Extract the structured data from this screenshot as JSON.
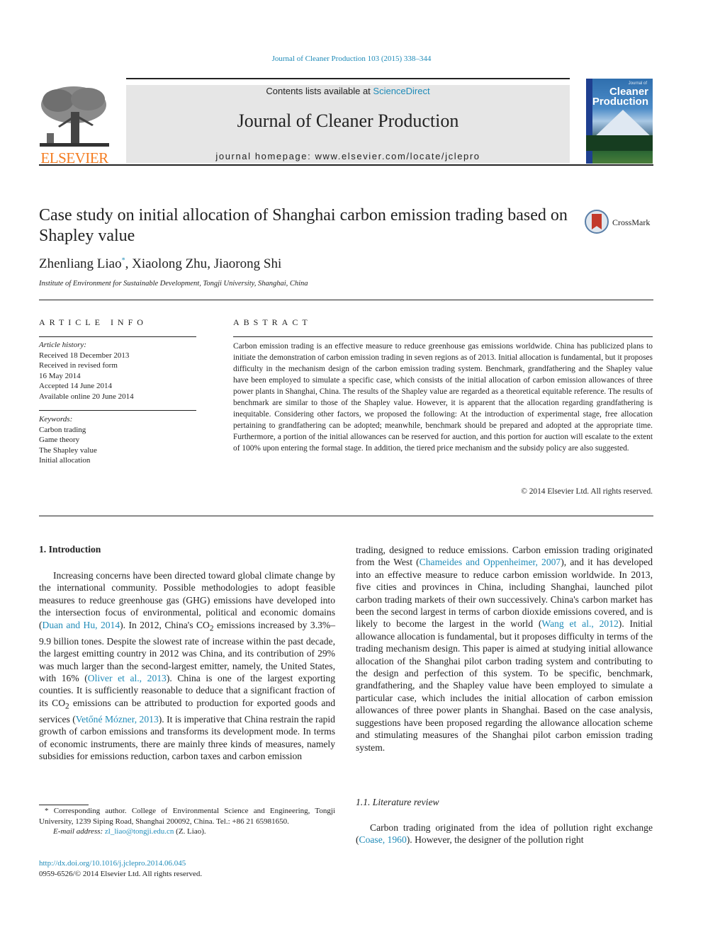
{
  "header": {
    "citation": "Journal of Cleaner Production 103 (2015) 338–344",
    "contents_prefix": "Contents lists available at ",
    "contents_link": "ScienceDirect",
    "journal_title": "Journal of Cleaner Production",
    "homepage": "journal homepage: www.elsevier.com/locate/jclepro",
    "publisher_logo": "ELSEVIER",
    "cover_small": "Journal of",
    "cover_title_1": "Cleaner",
    "cover_title_2": "Production",
    "brand_color": "#f47c20",
    "link_color": "#1f8bb8"
  },
  "article": {
    "title": "Case study on initial allocation of Shanghai carbon emission trading based on Shapley value",
    "crossmark_label": "CrossMark",
    "authors": [
      {
        "name": "Zhenliang Liao",
        "mark": "*"
      },
      {
        "name": "Xiaolong Zhu"
      },
      {
        "name": "Jiaorong Shi"
      }
    ],
    "author_sep": ", ",
    "affiliation": "Institute of Environment for Sustainable Development, Tongji University, Shanghai, China"
  },
  "article_info": {
    "heading": "ARTICLE INFO",
    "history_label": "Article history:",
    "history": [
      "Received 18 December 2013",
      "Received in revised form",
      "16 May 2014",
      "Accepted 14 June 2014",
      "Available online 20 June 2014"
    ],
    "keywords_label": "Keywords:",
    "keywords": [
      "Carbon trading",
      "Game theory",
      "The Shapley value",
      "Initial allocation"
    ]
  },
  "abstract": {
    "heading": "ABSTRACT",
    "text": "Carbon emission trading is an effective measure to reduce greenhouse gas emissions worldwide. China has publicized plans to initiate the demonstration of carbon emission trading in seven regions as of 2013. Initial allocation is fundamental, but it proposes difficulty in the mechanism design of the carbon emission trading system. Benchmark, grandfathering and the Shapley value have been employed to simulate a specific case, which consists of the initial allocation of carbon emission allowances of three power plants in Shanghai, China. The results of the Shapley value are regarded as a theoretical equitable reference. The results of benchmark are similar to those of the Shapley value. However, it is apparent that the allocation regarding grandfathering is inequitable. Considering other factors, we proposed the following: At the introduction of experimental stage, free allocation pertaining to grandfathering can be adopted; meanwhile, benchmark should be prepared and adopted at the appropriate time. Furthermore, a portion of the initial allowances can be reserved for auction, and this portion for auction will escalate to the extent of 100% upon entering the formal stage. In addition, the tiered price mechanism and the subsidy policy are also suggested.",
    "copyright": "© 2014 Elsevier Ltd. All rights reserved."
  },
  "body": {
    "section1_heading": "1.  Introduction",
    "p1": [
      {
        "t": "Increasing concerns have been directed toward global climate change by the international community. Possible methodologies to adopt feasible measures to reduce greenhouse gas (GHG) emissions have developed into the intersection focus of environmental, political and economic domains ("
      },
      {
        "t": "Duan and Hu, 2014",
        "link": true
      },
      {
        "t": "). In 2012, China's CO"
      },
      {
        "t": "2",
        "sub": true
      },
      {
        "t": " emissions increased by 3.3%–9.9 billion tones. Despite the slowest rate of increase within the past decade, the largest emitting country in 2012 was China, and its contribution of 29% was much larger than the second-largest emitter, namely, the United States, with 16% ("
      },
      {
        "t": "Oliver et al., 2013",
        "link": true
      },
      {
        "t": "). China is one of the largest exporting counties. It is sufficiently reasonable to deduce that a significant fraction of its CO"
      },
      {
        "t": "2",
        "sub": true
      },
      {
        "t": " emissions can be attributed to production for exported goods and services ("
      },
      {
        "t": "Vetőné Mózner, 2013",
        "link": true
      },
      {
        "t": "). It is imperative that China restrain the rapid growth of carbon emissions and transforms its development mode. In terms of economic instruments, there are mainly three kinds of measures, namely subsidies for emissions reduction, carbon taxes and carbon emission"
      }
    ],
    "p1_cont": [
      {
        "t": "trading, designed to reduce emissions. Carbon emission trading originated from the West ("
      },
      {
        "t": "Chameides and Oppenheimer, 2007",
        "link": true
      },
      {
        "t": "), and it has developed into an effective measure to reduce carbon emission worldwide. In 2013, five cities and provinces in China, including Shanghai, launched pilot carbon trading markets of their own successively. China's carbon market has been the second largest in terms of carbon dioxide emissions covered, and is likely to become the largest in the world ("
      },
      {
        "t": "Wang et al., 2012",
        "link": true
      },
      {
        "t": "). Initial allowance allocation is fundamental, but it proposes difficulty in terms of the trading mechanism design. This paper is aimed at studying initial allowance allocation of the Shanghai pilot carbon trading system and contributing to the design and perfection of this system. To be specific, benchmark, grandfathering, and the Shapley value have been employed to simulate a particular case, which includes the initial allocation of carbon emission allowances of three power plants in Shanghai. Based on the case analysis, suggestions have been proposed regarding the allowance allocation scheme and stimulating measures of the Shanghai pilot carbon emission trading system."
      }
    ],
    "section11_heading": "1.1.  Literature review",
    "p2": [
      {
        "t": "Carbon trading originated from the idea of pollution right exchange ("
      },
      {
        "t": "Coase, 1960",
        "link": true
      },
      {
        "t": "). However, the designer of the pollution right"
      }
    ]
  },
  "footnote": {
    "corresponding": "* Corresponding author. College of Environmental Science and Engineering, Tongji University, 1239 Siping Road, Shanghai 200092, China. Tel.: +86 21 65981650.",
    "email_label": "E-mail address: ",
    "email": "zl_liao@tongji.edu.cn",
    "email_suffix": " (Z. Liao).",
    "doi": "http://dx.doi.org/10.1016/j.jclepro.2014.06.045",
    "issn": "0959-6526/© 2014 Elsevier Ltd. All rights reserved."
  }
}
